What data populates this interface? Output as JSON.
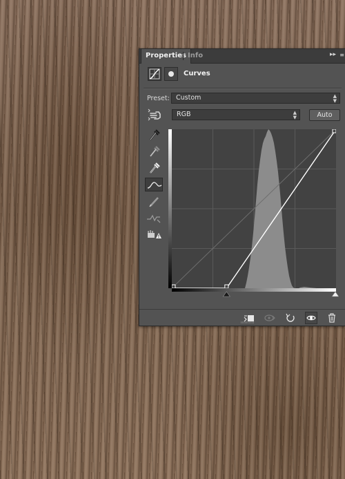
{
  "panel": {
    "tabs": [
      {
        "label": "Properties",
        "active": true
      },
      {
        "label": "Info",
        "active": false
      }
    ],
    "collapse_label": "▸▸",
    "menu_label": "≡",
    "title": "Curves",
    "preset_label": "Preset:",
    "preset_value": "Custom",
    "channel_value": "RGB",
    "auto_label": "Auto"
  },
  "curve": {
    "points": [
      [
        0,
        0
      ],
      [
        85,
        0
      ],
      [
        255,
        255
      ]
    ]
  },
  "colors": {
    "panel_bg": "#535353",
    "graph_bg": "#424242",
    "histogram": "#8a8a8a",
    "curve_line": "#ffffff"
  }
}
